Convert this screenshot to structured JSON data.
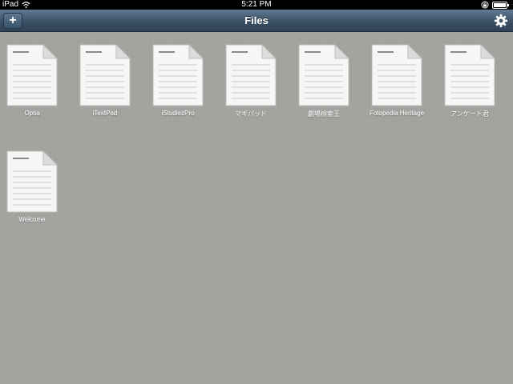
{
  "status_bar": {
    "carrier": "iPad",
    "time": "5:21 PM",
    "icons": [
      "wifi-icon",
      "orientation-lock-icon",
      "battery-icon"
    ]
  },
  "nav_bar": {
    "title": "Files",
    "add_label": "+",
    "left_icon": "add-icon",
    "right_icon": "gear-icon"
  },
  "files": [
    {
      "name": "Optia",
      "icon": "document-icon"
    },
    {
      "name": "iTextPad",
      "icon": "document-icon"
    },
    {
      "name": "iStudiezPro",
      "icon": "document-icon"
    },
    {
      "name": "マギパッド",
      "icon": "document-icon"
    },
    {
      "name": "劇場検索王",
      "icon": "document-icon"
    },
    {
      "name": "Fotopedia Heritage",
      "icon": "document-icon"
    },
    {
      "name": "アンケート君",
      "icon": "document-icon"
    },
    {
      "name": "Welcome",
      "icon": "document-icon"
    }
  ],
  "colors": {
    "nav_bar": "#3b5065",
    "background": "#a4a3a0",
    "label_text": "#ffffff"
  }
}
